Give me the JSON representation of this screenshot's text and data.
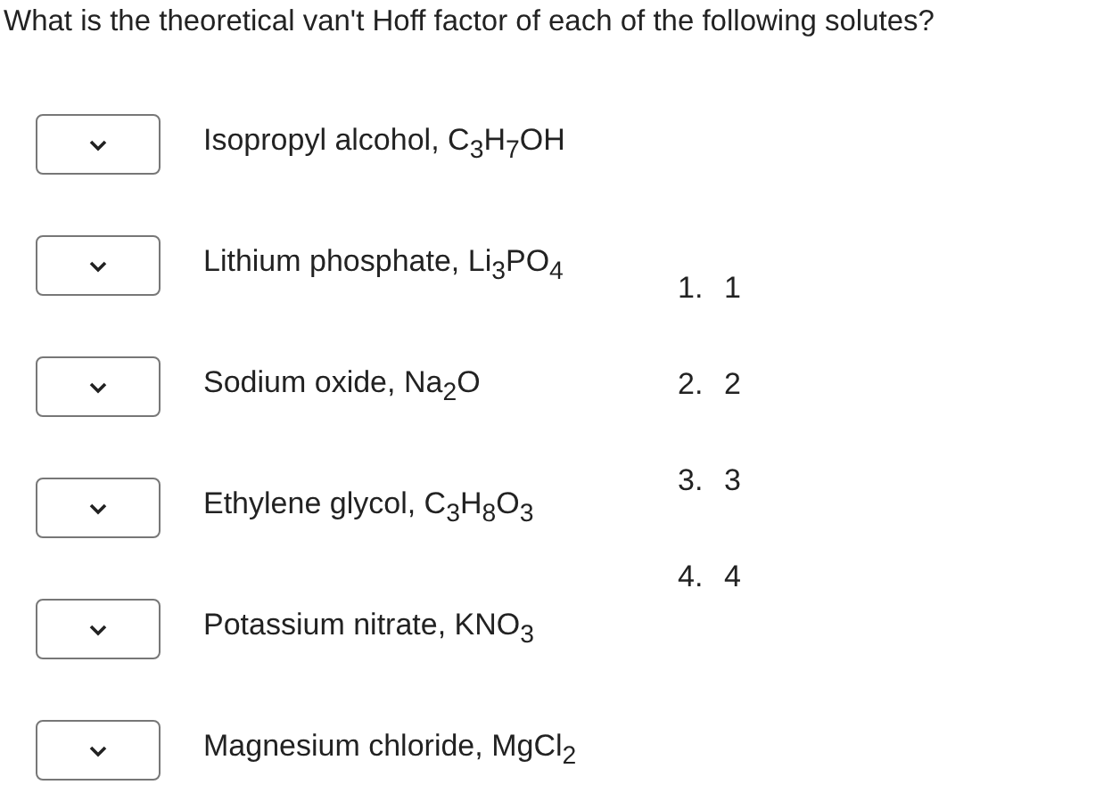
{
  "question": "What is the theoretical van't Hoff factor of each of the following solutes?",
  "items": [
    {
      "label": "Isopropyl alcohol, C$_{3}$H$_{7}$OH"
    },
    {
      "label": "Lithium phosphate, Li$_{3}$PO$_{4}$"
    },
    {
      "label": "Sodium oxide, Na$_{2}$O"
    },
    {
      "label": "Ethylene glycol, C$_{3}$H$_{8}$O$_{3}$"
    },
    {
      "label": "Potassium nitrate, KNO$_{3}$"
    },
    {
      "label": "Magnesium chloride, MgCl$_{2}$"
    }
  ],
  "options": [
    {
      "number": "1.",
      "text": "1"
    },
    {
      "number": "2.",
      "text": "2"
    },
    {
      "number": "3.",
      "text": "3"
    },
    {
      "number": "4.",
      "text": "4"
    }
  ]
}
